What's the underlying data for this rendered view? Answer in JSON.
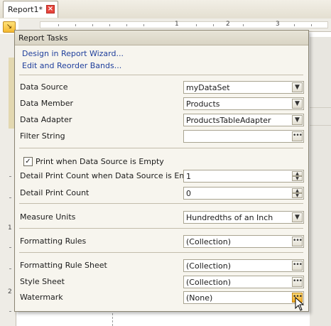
{
  "document_tab": {
    "title": "Report1*"
  },
  "ruler": {
    "top_numbers": [
      "1",
      "2",
      "3"
    ],
    "left_numbers": [
      "1",
      "2"
    ]
  },
  "panel": {
    "title": "Report Tasks",
    "links": [
      "Design in Report Wizard...",
      "Edit and Reorder Bands..."
    ],
    "data_source": {
      "label": "Data Source",
      "value": "myDataSet"
    },
    "data_member": {
      "label": "Data Member",
      "value": "Products"
    },
    "data_adapter": {
      "label": "Data Adapter",
      "value": "ProductsTableAdapter"
    },
    "filter_string": {
      "label": "Filter String",
      "value": ""
    },
    "print_when_empty": {
      "label": "Print when Data Source is Empty",
      "checked": true
    },
    "detail_print_count_empty": {
      "label": "Detail Print Count when Data Source is Empty",
      "value": "1"
    },
    "detail_print_count": {
      "label": "Detail Print Count",
      "value": "0"
    },
    "measure_units": {
      "label": "Measure Units",
      "value": "Hundredths of an Inch"
    },
    "formatting_rules": {
      "label": "Formatting Rules",
      "value": "(Collection)"
    },
    "formatting_rule_sheet": {
      "label": "Formatting Rule Sheet",
      "value": "(Collection)"
    },
    "style_sheet": {
      "label": "Style Sheet",
      "value": "(Collection)"
    },
    "watermark": {
      "label": "Watermark",
      "value": "(None)"
    }
  },
  "icons": {
    "close": "close-icon",
    "dropdown": "chevron-down-icon",
    "ellipsis": "ellipsis-icon",
    "spin_up": "spin-up-icon",
    "spin_down": "spin-down-icon",
    "cursor": "mouse-pointer-icon"
  },
  "colors": {
    "link": "#1f3f9c",
    "accent": "#f2a91e",
    "close": "#e8453c"
  }
}
